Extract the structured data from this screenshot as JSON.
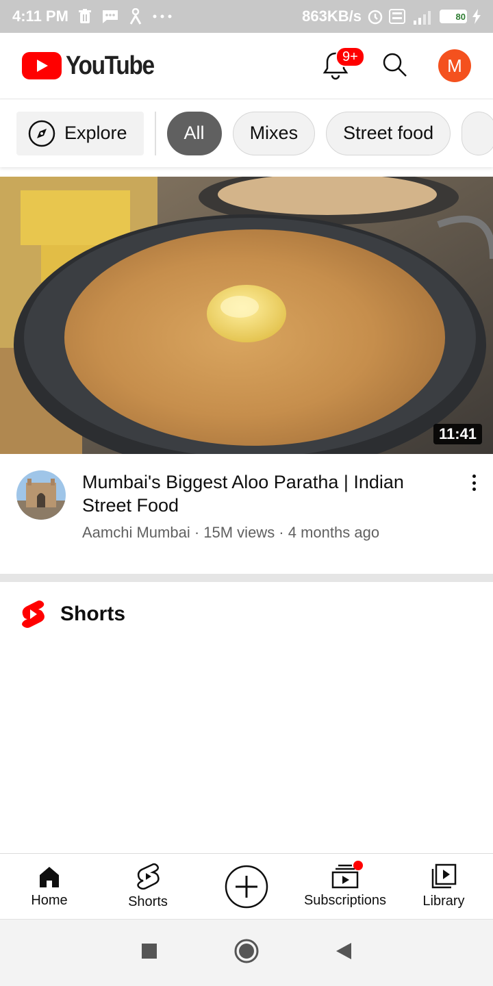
{
  "status_bar": {
    "time": "4:11 PM",
    "network_speed": "863KB/s",
    "battery": "80",
    "battery_level": 0.8,
    "icons": [
      "trash-icon",
      "message-icon",
      "person-icon",
      "more-dots-icon",
      "alarm-icon",
      "volte-icon",
      "signal-icon",
      "battery-icon",
      "charging-icon"
    ]
  },
  "header": {
    "logo_text": "YouTube",
    "notifications_badge": "9+",
    "avatar_initial": "M",
    "brand_color": "#ff0000",
    "avatar_color": "#f4511e"
  },
  "chips": {
    "explore_label": "Explore",
    "items": [
      "All",
      "Mixes",
      "Street food"
    ],
    "active": "All"
  },
  "video": {
    "duration": "11:41",
    "title": "Mumbai's Biggest Aloo Paratha | Indian Street Food",
    "subtitle": "Aamchi Mumbai · 15M views · 4 months ago"
  },
  "shorts_section": {
    "title": "Shorts"
  },
  "bottom_nav": {
    "home": "Home",
    "shorts": "Shorts",
    "subscriptions": "Subscriptions",
    "library": "Library"
  }
}
